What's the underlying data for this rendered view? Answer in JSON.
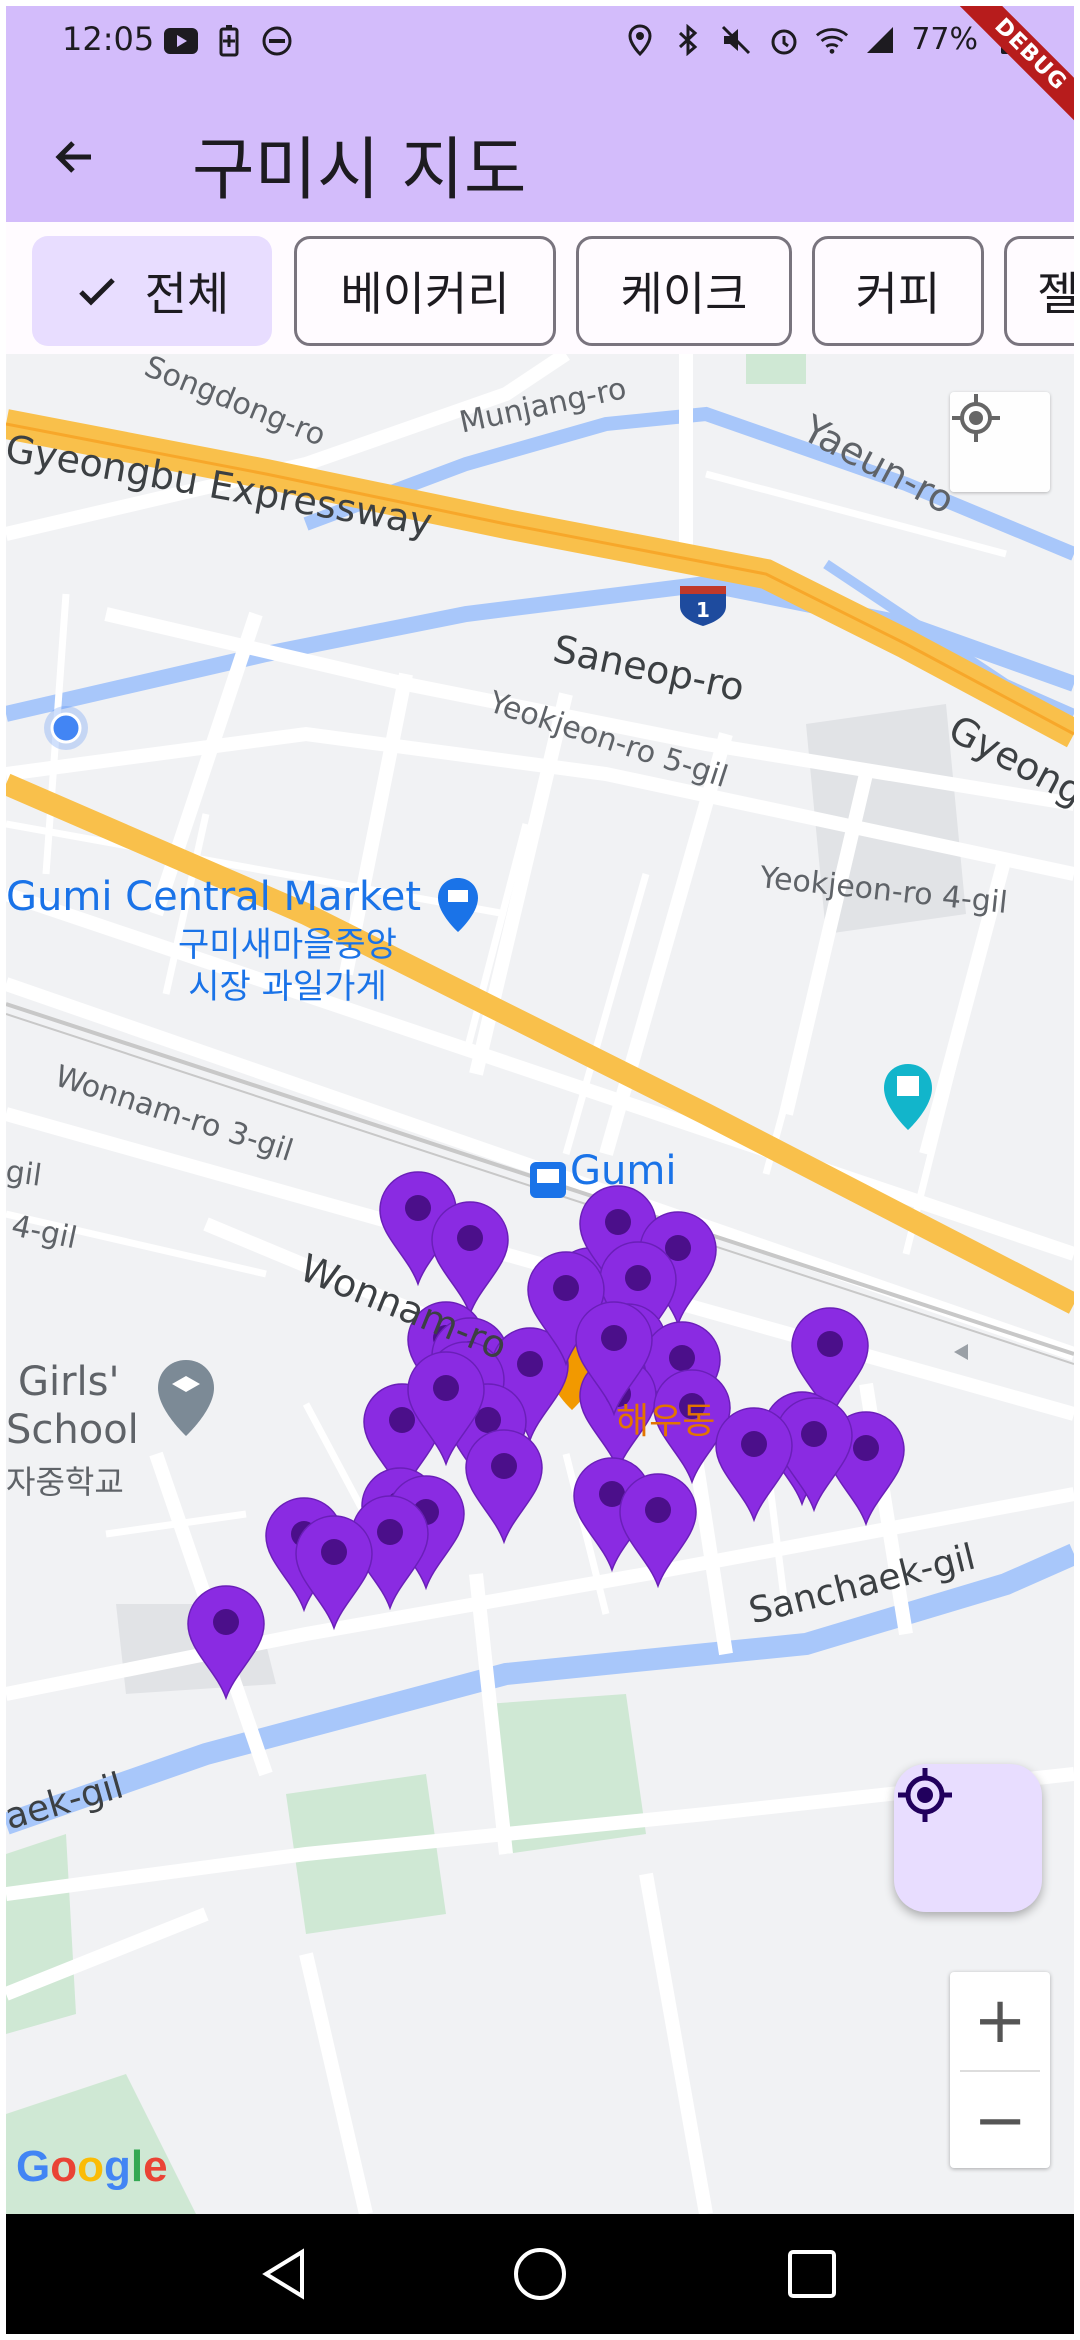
{
  "status_bar": {
    "time": "12:05",
    "battery": "77%",
    "left_icons": [
      "youtube-icon",
      "battery-saver-icon",
      "dnd-icon"
    ],
    "right_icons": [
      "location-icon",
      "bluetooth-icon",
      "mute-icon",
      "alarm-icon",
      "wifi-icon",
      "signal-icon",
      "battery-icon"
    ]
  },
  "debug_banner": "DEBUG",
  "app_bar": {
    "title": "구미시 지도",
    "back_icon": "arrow-back-icon"
  },
  "filter_chips": [
    {
      "label": "전체",
      "selected": true
    },
    {
      "label": "베이커리",
      "selected": false
    },
    {
      "label": "케이크",
      "selected": false
    },
    {
      "label": "커피",
      "selected": false
    },
    {
      "label": "젤",
      "selected": false
    }
  ],
  "map": {
    "labels": {
      "songdong": "Songdong-ro",
      "munjang": "Munjang-ro",
      "yaeun": "Yaeun-ro",
      "expressway": "Gyeongbu Expressway",
      "expressway_right": "Gyeong",
      "saneop": "Saneop-ro",
      "yeokjeon5": "Yeokjeon-ro 5-gil",
      "yeokjeon4": "Yeokjeon-ro 4-gil",
      "market_en": "Gumi Central Market",
      "market_kr_1": "구미새마을중앙",
      "market_kr_2": "시장 과일가게",
      "wonnam3": "Wonnam-ro 3-gil",
      "wonnam": "Wonnam-ro",
      "gil_a": "gil",
      "gil_b": "4-gil",
      "station": "Gumi",
      "school_en_1": "Girls'",
      "school_en_2": "School",
      "school_kr": "자중학교",
      "restaurant_kr": "해우동",
      "sanchaek": "Sanchaek-gil",
      "aek": "aek-gil",
      "highway_number": "1"
    },
    "marker_color": "#8a2be2",
    "marker_count": 33,
    "google_logo": "Google",
    "my_location_button_icon": "my-location-icon",
    "fab_icon": "gps-fixed-icon",
    "zoom_in": "+",
    "zoom_out": "−"
  },
  "nav_bar": {
    "back": "nav-back-icon",
    "home": "nav-home-icon",
    "recents": "nav-recents-icon"
  },
  "colors": {
    "app_bar": "#d3bcfb",
    "chip_selected": "#e8ddff",
    "marker": "#8a2be2",
    "expressway": "#f9c04b",
    "river": "#a8c7fa"
  }
}
